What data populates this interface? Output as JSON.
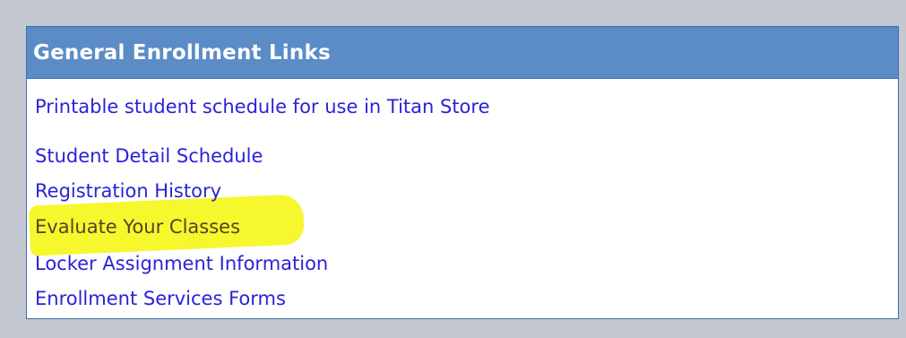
{
  "panel": {
    "title": "General Enrollment Links"
  },
  "links": [
    {
      "label": "Printable student schedule for use in Titan Store"
    },
    {
      "label": "Student Detail Schedule"
    },
    {
      "label": "Registration History"
    },
    {
      "label": "Evaluate Your Classes"
    },
    {
      "label": "Locker Assignment Information"
    },
    {
      "label": "Enrollment Services Forms"
    }
  ],
  "colors": {
    "page_background": "#c3c8d3",
    "header_background": "#5b8cc6",
    "border": "#3f6ea5",
    "link": "#2b22d6",
    "highlight": "#f6f722"
  }
}
